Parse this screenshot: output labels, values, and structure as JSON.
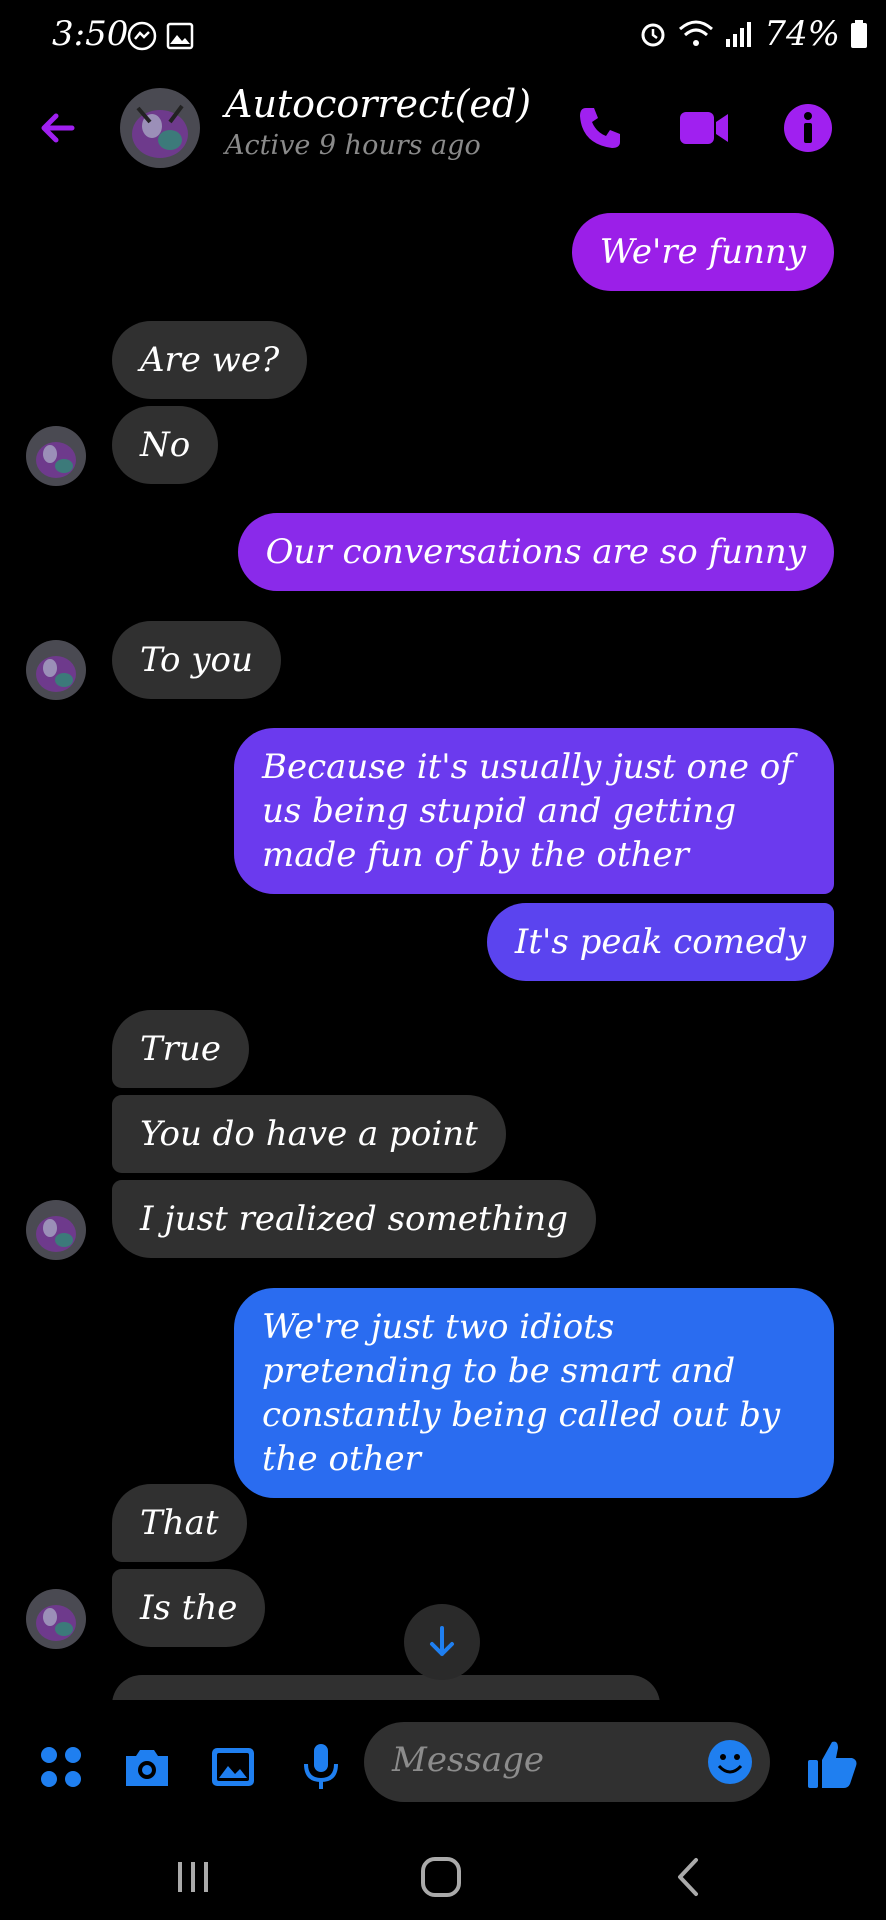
{
  "status_bar": {
    "time": "3:50",
    "battery": "74%",
    "icons": [
      "messenger-icon",
      "image-icon",
      "alarm-icon",
      "wifi-icon",
      "signal-icon",
      "battery-icon"
    ]
  },
  "header": {
    "contact_name": "Autocorrect(ed)",
    "status": "Active 9 hours ago",
    "icons": [
      "back-arrow-icon",
      "phone-icon",
      "video-icon",
      "info-icon"
    ]
  },
  "colors": {
    "accent": "#a020f0",
    "incoming_bubble": "#303030",
    "outgoing_purple": "#9b1fe8",
    "outgoing_violet": "#7a35ec",
    "outgoing_indigo": "#5a4ff0",
    "outgoing_blue": "#2a6cf0",
    "composer_blue": "#1f7ff0"
  },
  "messages": [
    {
      "text": "We're funny",
      "direction": "out"
    },
    {
      "text": "Are we?",
      "direction": "in"
    },
    {
      "text": "No",
      "direction": "in"
    },
    {
      "text": "Our conversations are so funny",
      "direction": "out"
    },
    {
      "text": "To you",
      "direction": "in"
    },
    {
      "text": "Because it's usually just one of us being stupid and getting made fun of by the other",
      "direction": "out"
    },
    {
      "text": "It's peak comedy",
      "direction": "out"
    },
    {
      "text": "True",
      "direction": "in"
    },
    {
      "text": "You do have a point",
      "direction": "in"
    },
    {
      "text": "I just realized something",
      "direction": "in"
    },
    {
      "text": "We're just two idiots pretending to be smart and constantly being called out by the other",
      "direction": "out"
    },
    {
      "text": "That",
      "direction": "in"
    },
    {
      "text": "Is the",
      "direction": "in"
    }
  ],
  "composer": {
    "placeholder": "Message",
    "icons": [
      "menu-grid-icon",
      "camera-icon",
      "gallery-icon",
      "microphone-icon",
      "emoji-icon",
      "thumbs-up-icon"
    ]
  },
  "nav": {
    "icons": [
      "recents-icon",
      "home-icon",
      "back-icon"
    ]
  }
}
